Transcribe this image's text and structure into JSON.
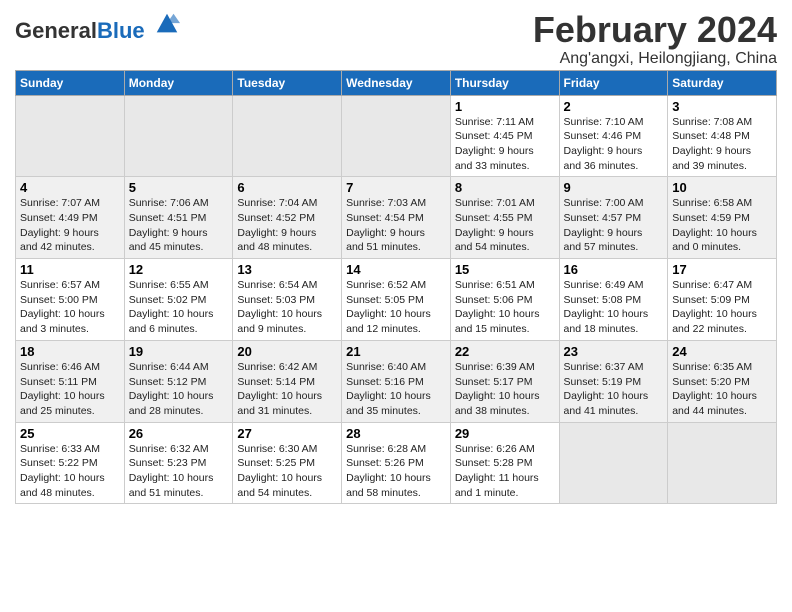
{
  "header": {
    "logo_text_general": "General",
    "logo_text_blue": "Blue",
    "main_title": "February 2024",
    "subtitle": "Ang'angxi, Heilongjiang, China"
  },
  "calendar": {
    "days_of_week": [
      "Sunday",
      "Monday",
      "Tuesday",
      "Wednesday",
      "Thursday",
      "Friday",
      "Saturday"
    ],
    "weeks": [
      [
        {
          "day": "",
          "info": ""
        },
        {
          "day": "",
          "info": ""
        },
        {
          "day": "",
          "info": ""
        },
        {
          "day": "",
          "info": ""
        },
        {
          "day": "1",
          "info": "Sunrise: 7:11 AM\nSunset: 4:45 PM\nDaylight: 9 hours\nand 33 minutes."
        },
        {
          "day": "2",
          "info": "Sunrise: 7:10 AM\nSunset: 4:46 PM\nDaylight: 9 hours\nand 36 minutes."
        },
        {
          "day": "3",
          "info": "Sunrise: 7:08 AM\nSunset: 4:48 PM\nDaylight: 9 hours\nand 39 minutes."
        }
      ],
      [
        {
          "day": "4",
          "info": "Sunrise: 7:07 AM\nSunset: 4:49 PM\nDaylight: 9 hours\nand 42 minutes."
        },
        {
          "day": "5",
          "info": "Sunrise: 7:06 AM\nSunset: 4:51 PM\nDaylight: 9 hours\nand 45 minutes."
        },
        {
          "day": "6",
          "info": "Sunrise: 7:04 AM\nSunset: 4:52 PM\nDaylight: 9 hours\nand 48 minutes."
        },
        {
          "day": "7",
          "info": "Sunrise: 7:03 AM\nSunset: 4:54 PM\nDaylight: 9 hours\nand 51 minutes."
        },
        {
          "day": "8",
          "info": "Sunrise: 7:01 AM\nSunset: 4:55 PM\nDaylight: 9 hours\nand 54 minutes."
        },
        {
          "day": "9",
          "info": "Sunrise: 7:00 AM\nSunset: 4:57 PM\nDaylight: 9 hours\nand 57 minutes."
        },
        {
          "day": "10",
          "info": "Sunrise: 6:58 AM\nSunset: 4:59 PM\nDaylight: 10 hours\nand 0 minutes."
        }
      ],
      [
        {
          "day": "11",
          "info": "Sunrise: 6:57 AM\nSunset: 5:00 PM\nDaylight: 10 hours\nand 3 minutes."
        },
        {
          "day": "12",
          "info": "Sunrise: 6:55 AM\nSunset: 5:02 PM\nDaylight: 10 hours\nand 6 minutes."
        },
        {
          "day": "13",
          "info": "Sunrise: 6:54 AM\nSunset: 5:03 PM\nDaylight: 10 hours\nand 9 minutes."
        },
        {
          "day": "14",
          "info": "Sunrise: 6:52 AM\nSunset: 5:05 PM\nDaylight: 10 hours\nand 12 minutes."
        },
        {
          "day": "15",
          "info": "Sunrise: 6:51 AM\nSunset: 5:06 PM\nDaylight: 10 hours\nand 15 minutes."
        },
        {
          "day": "16",
          "info": "Sunrise: 6:49 AM\nSunset: 5:08 PM\nDaylight: 10 hours\nand 18 minutes."
        },
        {
          "day": "17",
          "info": "Sunrise: 6:47 AM\nSunset: 5:09 PM\nDaylight: 10 hours\nand 22 minutes."
        }
      ],
      [
        {
          "day": "18",
          "info": "Sunrise: 6:46 AM\nSunset: 5:11 PM\nDaylight: 10 hours\nand 25 minutes."
        },
        {
          "day": "19",
          "info": "Sunrise: 6:44 AM\nSunset: 5:12 PM\nDaylight: 10 hours\nand 28 minutes."
        },
        {
          "day": "20",
          "info": "Sunrise: 6:42 AM\nSunset: 5:14 PM\nDaylight: 10 hours\nand 31 minutes."
        },
        {
          "day": "21",
          "info": "Sunrise: 6:40 AM\nSunset: 5:16 PM\nDaylight: 10 hours\nand 35 minutes."
        },
        {
          "day": "22",
          "info": "Sunrise: 6:39 AM\nSunset: 5:17 PM\nDaylight: 10 hours\nand 38 minutes."
        },
        {
          "day": "23",
          "info": "Sunrise: 6:37 AM\nSunset: 5:19 PM\nDaylight: 10 hours\nand 41 minutes."
        },
        {
          "day": "24",
          "info": "Sunrise: 6:35 AM\nSunset: 5:20 PM\nDaylight: 10 hours\nand 44 minutes."
        }
      ],
      [
        {
          "day": "25",
          "info": "Sunrise: 6:33 AM\nSunset: 5:22 PM\nDaylight: 10 hours\nand 48 minutes."
        },
        {
          "day": "26",
          "info": "Sunrise: 6:32 AM\nSunset: 5:23 PM\nDaylight: 10 hours\nand 51 minutes."
        },
        {
          "day": "27",
          "info": "Sunrise: 6:30 AM\nSunset: 5:25 PM\nDaylight: 10 hours\nand 54 minutes."
        },
        {
          "day": "28",
          "info": "Sunrise: 6:28 AM\nSunset: 5:26 PM\nDaylight: 10 hours\nand 58 minutes."
        },
        {
          "day": "29",
          "info": "Sunrise: 6:26 AM\nSunset: 5:28 PM\nDaylight: 11 hours\nand 1 minute."
        },
        {
          "day": "",
          "info": ""
        },
        {
          "day": "",
          "info": ""
        }
      ]
    ]
  }
}
